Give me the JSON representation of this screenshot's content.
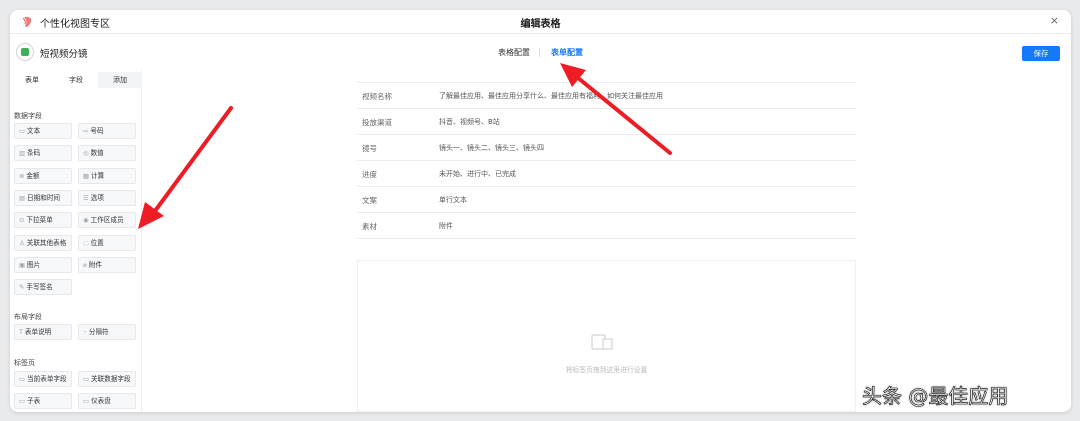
{
  "app": {
    "title": "个性化视图专区"
  },
  "dialog": {
    "title": "编辑表格",
    "close": "×"
  },
  "form": {
    "name": "短视频分镜"
  },
  "config_tabs": [
    {
      "label": "表格配置"
    },
    {
      "label": "表单配置"
    }
  ],
  "active_config_tab": "表单配置",
  "save_label": "保存",
  "sidebar": {
    "tabs": [
      {
        "label": "表单"
      },
      {
        "label": "字段"
      },
      {
        "label": "添加"
      }
    ],
    "active_tab": "添加",
    "data_fields_title": "数据字段",
    "data_fields": [
      {
        "label": "文本",
        "icon": "text-icon"
      },
      {
        "label": "号码",
        "icon": "number-icon"
      },
      {
        "label": "条码",
        "icon": "barcode-icon"
      },
      {
        "label": "数值",
        "icon": "numeric-icon"
      },
      {
        "label": "金额",
        "icon": "money-icon"
      },
      {
        "label": "计算",
        "icon": "calculator-icon"
      },
      {
        "label": "日期和时间",
        "icon": "calendar-icon"
      },
      {
        "label": "选项",
        "icon": "list-icon"
      },
      {
        "label": "下拉菜单",
        "icon": "dropdown-icon"
      },
      {
        "label": "工作区成员",
        "icon": "member-icon"
      },
      {
        "label": "关联其他表格",
        "icon": "link-icon"
      },
      {
        "label": "位置",
        "icon": "location-icon"
      },
      {
        "label": "图片",
        "icon": "image-icon"
      },
      {
        "label": "附件",
        "icon": "paperclip-icon"
      },
      {
        "label": "手写签名",
        "icon": "signature-icon"
      }
    ],
    "layout_fields_title": "布局字段",
    "layout_fields": [
      {
        "label": "表单说明",
        "icon": "text-t-icon"
      },
      {
        "label": "分隔符",
        "icon": "divider-icon"
      }
    ],
    "tab_page_title": "标签页",
    "tab_page_fields": [
      {
        "label": "当前表单字段",
        "icon": "tab-icon"
      },
      {
        "label": "关联数据字段",
        "icon": "tab-icon"
      },
      {
        "label": "子表",
        "icon": "tab-icon"
      },
      {
        "label": "仪表盘",
        "icon": "tab-icon"
      }
    ]
  },
  "form_rows": [
    {
      "label": "视频名称",
      "value": "了解最佳应用、最佳应用分享什么、最佳应用有福利、如何关注最佳应用"
    },
    {
      "label": "投放渠道",
      "value": "抖音、视频号、B站"
    },
    {
      "label": "镜号",
      "value": "镜头一、镜头二、镜头三、镜头四"
    },
    {
      "label": "进度",
      "value": "未开始、进行中、已完成"
    },
    {
      "label": "文案",
      "value": "单行文本"
    },
    {
      "label": "素材",
      "value": "附件"
    }
  ],
  "drop_area": {
    "hint": "将标签页拖到这里进行设置"
  },
  "watermark": "头条 @最佳应用",
  "colors": {
    "accent": "#1677ff",
    "arrow": "#ee1c24"
  }
}
